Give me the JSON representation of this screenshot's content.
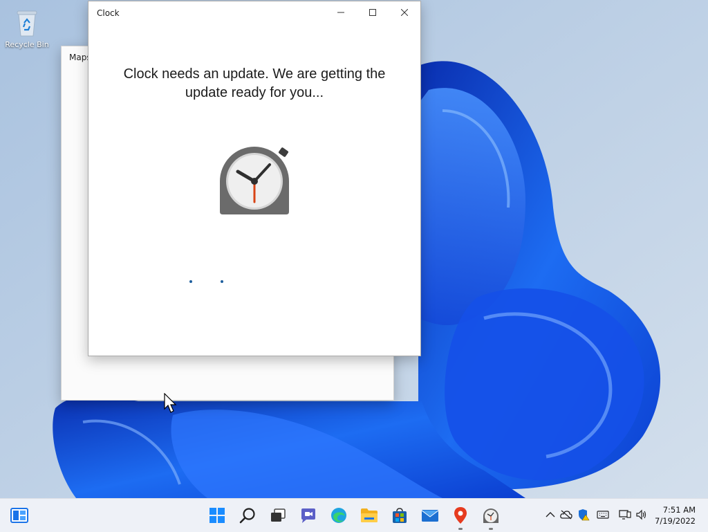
{
  "desktop": {
    "icons": [
      {
        "label": "Recycle Bin",
        "icon": "recycle-bin-icon"
      }
    ]
  },
  "windows": {
    "maps": {
      "title": "Maps"
    },
    "clock": {
      "title": "Clock",
      "message": "Clock needs an update. We are getting the update ready for you...",
      "app_icon": "clock-app-icon",
      "controls": {
        "minimize": "minimize-icon",
        "maximize": "maximize-icon",
        "close": "close-icon"
      }
    }
  },
  "taskbar": {
    "widgets_icon": "widgets-icon",
    "apps": [
      {
        "name": "Start",
        "icon": "windows-logo-icon"
      },
      {
        "name": "Search",
        "icon": "search-icon"
      },
      {
        "name": "Task View",
        "icon": "task-view-icon"
      },
      {
        "name": "Chat",
        "icon": "chat-icon"
      },
      {
        "name": "Microsoft Edge",
        "icon": "edge-icon"
      },
      {
        "name": "File Explorer",
        "icon": "folder-icon"
      },
      {
        "name": "Microsoft Store",
        "icon": "store-icon"
      },
      {
        "name": "Mail",
        "icon": "mail-icon"
      },
      {
        "name": "Maps",
        "icon": "maps-pin-icon",
        "running": true
      },
      {
        "name": "Clock",
        "icon": "clock-icon",
        "running": true
      }
    ],
    "tray": {
      "icons": [
        "chevron-up-icon",
        "onedrive-offline-icon",
        "security-warning-icon",
        "keyboard-icon",
        "network-icon",
        "volume-icon"
      ],
      "time": "7:51 AM",
      "date": "7/19/2022"
    }
  },
  "colors": {
    "wallpaper_bg": "#b9cde4",
    "bloom_blue": "#1a5fe8",
    "taskbar_bg": "#eef1f7",
    "clock_hand_red": "#d84315"
  }
}
